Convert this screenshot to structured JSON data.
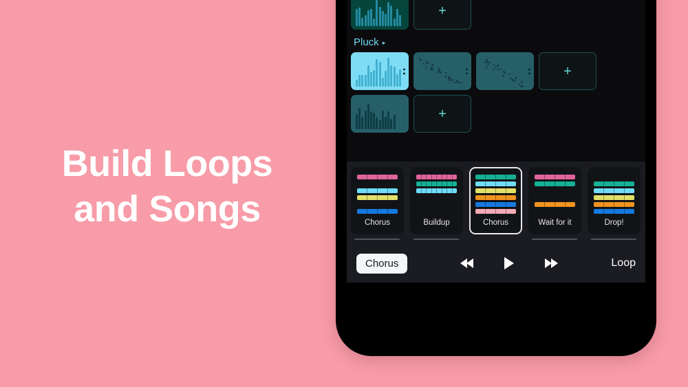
{
  "marketing": {
    "headline_line1": "Build Loops",
    "headline_line2": "and Songs",
    "background_color": "#f79ca8",
    "text_color": "#ffffff"
  },
  "app": {
    "clip_browser": {
      "top_row": {
        "clips": [
          {
            "name": "clip-green",
            "state": "partially-visible",
            "color": "#05463c"
          }
        ],
        "add_label": "+"
      },
      "group": {
        "label": "Pluck",
        "caret": "▸",
        "accent_color": "#6fd4ef"
      },
      "row_1": {
        "clips": [
          {
            "name": "clip-pluck-1",
            "state": "selected",
            "color": "#7fdcf5"
          },
          {
            "name": "clip-pluck-2",
            "state": "idle",
            "color": "#275f68"
          },
          {
            "name": "clip-pluck-3",
            "state": "idle",
            "color": "#275f68"
          }
        ],
        "add_label": "+"
      },
      "row_2": {
        "clips": [
          {
            "name": "clip-pluck-4",
            "state": "idle",
            "color": "#275f68"
          }
        ],
        "add_label": "+"
      }
    },
    "song_sections": {
      "cards": [
        {
          "label": "Chorus",
          "active": false,
          "segments": 4,
          "tracks": [
            "#e0649b",
            "",
            "#6fdcf8",
            "#e3e06a",
            "",
            "#1579e0"
          ]
        },
        {
          "label": "Buildup",
          "active": false,
          "segments": 8,
          "tracks": [
            "#e0649b",
            "#16b095",
            "#6fdcf8",
            "",
            "",
            ""
          ]
        },
        {
          "label": "Chorus",
          "active": true,
          "segments": 4,
          "tracks": [
            "#16b095",
            "#6fdcf8",
            "#e3e06a",
            "#f2941f",
            "#1579e0",
            "#f7abb5"
          ]
        },
        {
          "label": "Wait for it",
          "active": false,
          "segments": 4,
          "tracks": [
            "#e0649b",
            "#16b095",
            "",
            "",
            "#f2941f",
            ""
          ]
        },
        {
          "label": "Drop!",
          "active": false,
          "segments": 4,
          "tracks": [
            "",
            "#16b095",
            "#6fdcf8",
            "#e3e06a",
            "#f2941f",
            "#1579e0"
          ]
        },
        {
          "label": "",
          "active": false,
          "segments": 4,
          "tracks": [
            "#e0649b",
            "#16b095",
            "",
            "#f2941f",
            "",
            ""
          ]
        }
      ]
    },
    "transport": {
      "section_pill": "Chorus",
      "rewind_icon": "rewind-icon",
      "play_icon": "play-icon",
      "forward_icon": "fast-forward-icon",
      "loop_label": "Loop"
    }
  }
}
